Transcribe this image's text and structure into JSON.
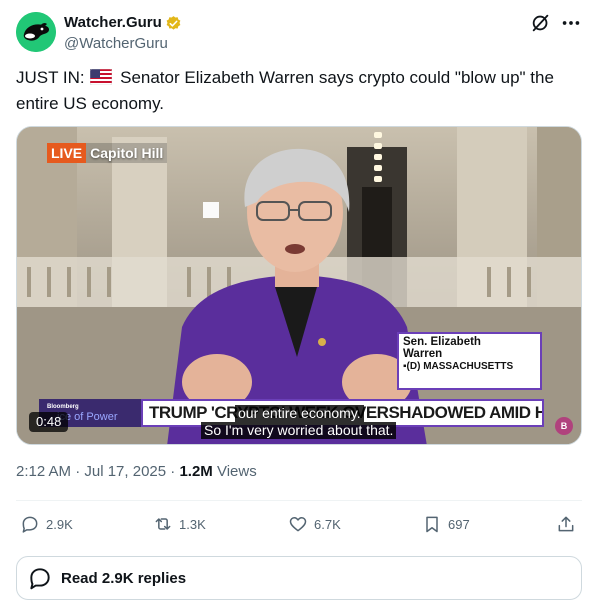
{
  "author": {
    "display_name": "Watcher.Guru",
    "handle": "@WatcherGuru"
  },
  "tweet": {
    "text_prefix": "JUST IN:",
    "text_body": "Senator Elizabeth Warren says crypto could \"blow up\" the entire US economy."
  },
  "video": {
    "live_tag": "LIVE",
    "live_location": "Capitol Hill",
    "lower_third_name_1": "Sen. Elizabeth",
    "lower_third_name_2": "Warren",
    "lower_third_party": "(D) MASSACHUSETTS",
    "chyron": "TRUMP 'CRYPTO' WEEK OVERSHADOWED AMID HOUSE GOP IMPASSE",
    "network_small": "Bloomberg",
    "network_show": "ice of Power",
    "caption_line_1": "our entire economy.",
    "caption_line_2": "So I'm very worried about that.",
    "duration": "0:48",
    "corner_logo": "B"
  },
  "meta": {
    "timestamp": "2:12 AM · Jul 17, 2025 · ",
    "views_count": "1.2M",
    "views_label": " Views"
  },
  "actions": {
    "replies": "2.9K",
    "reposts": "1.3K",
    "likes": "6.7K",
    "bookmarks": "697"
  },
  "read_replies": "Read 2.9K replies",
  "colors": {
    "accent_green": "#21c776",
    "verified_gold": "#e2b719",
    "muted_text": "#536471",
    "live_orange": "#e65a1e",
    "chyron_border": "#6b3fb8"
  }
}
